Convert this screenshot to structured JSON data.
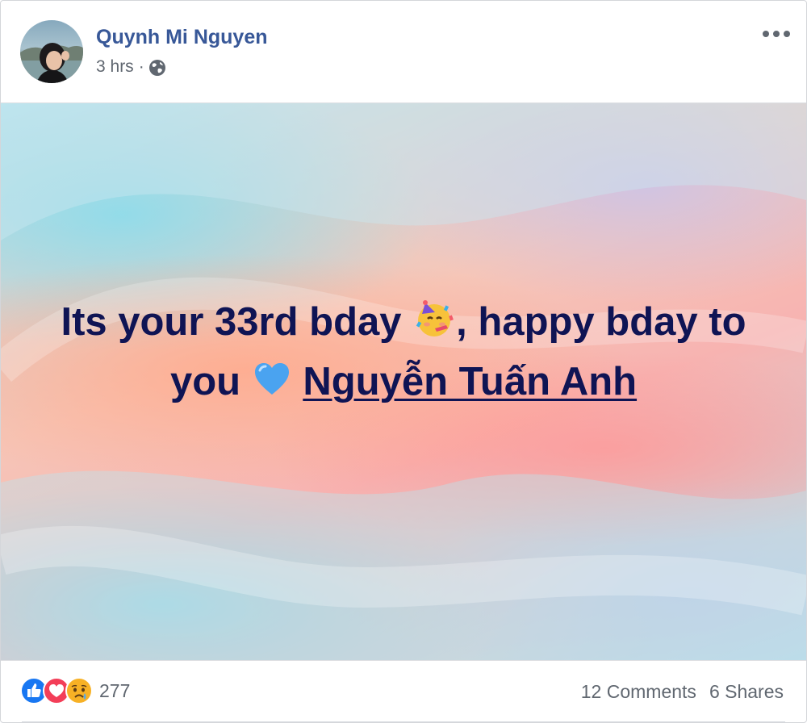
{
  "post": {
    "author": "Quynh Mi Nguyen",
    "time": "3 hrs",
    "separator": "·",
    "privacy_icon": "globe-icon",
    "more_icon": "more-options-icon",
    "text_part1": "Its your 33rd bday",
    "emoji_party": "party-face-emoji",
    "text_part2": ", happy bday to you",
    "emoji_heart": "blue-heart-emoji",
    "mention": "Nguyễn Tuấn Anh",
    "text_color": "#0f1454"
  },
  "footer": {
    "reaction_icons": [
      "like-icon",
      "love-icon",
      "sad-icon"
    ],
    "reaction_count": "277",
    "comments": "12 Comments",
    "shares": "6 Shares"
  },
  "colors": {
    "author_link": "#385898",
    "meta_text": "#606770",
    "like_blue": "#1877f2",
    "love_red": "#f33e58",
    "sad_yellow": "#f7b125"
  }
}
